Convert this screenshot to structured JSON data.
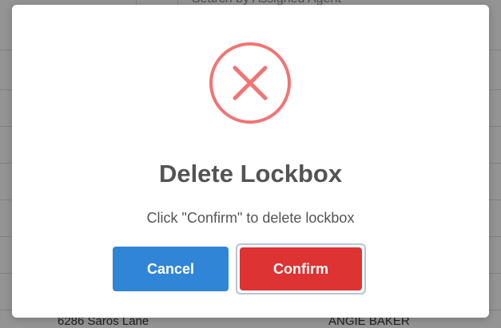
{
  "background": {
    "search_placeholder": "Search by Assigned Agent",
    "row_address": "6286 Saros Lane",
    "row_agent": "ANGIE BAKER"
  },
  "modal": {
    "icon": "error-x-icon",
    "title": "Delete Lockbox",
    "message": "Click \"Confirm\" to delete lockbox",
    "cancel_label": "Cancel",
    "confirm_label": "Confirm"
  },
  "colors": {
    "icon": "#f27474",
    "cancel": "#3085d6",
    "confirm": "#dd3333",
    "text": "#545454"
  }
}
